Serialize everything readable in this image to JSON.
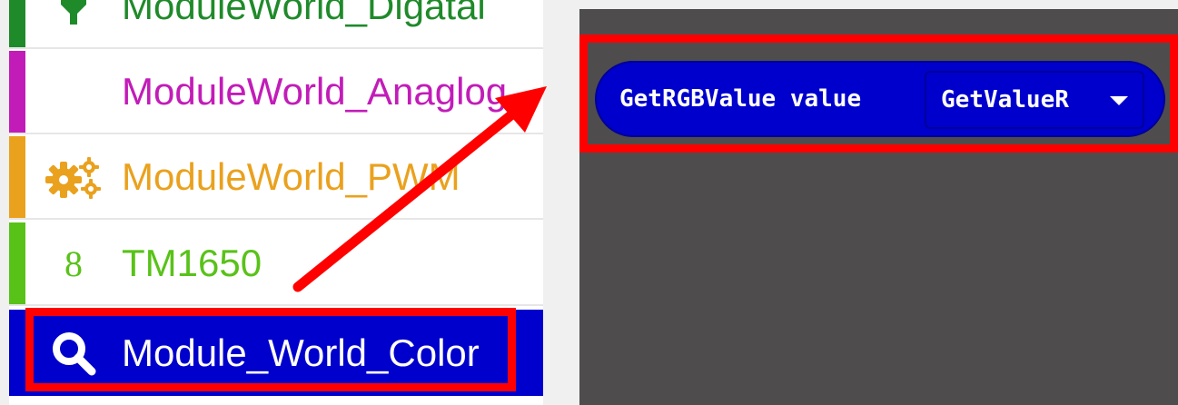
{
  "sidebar": {
    "items": [
      {
        "label": "ModuleWorld_Digatal",
        "color": "#1f8a2a",
        "icon": "plug-icon"
      },
      {
        "label": "ModuleWorld_Anaglog",
        "color": "#c21cb8",
        "icon": ""
      },
      {
        "label": "ModuleWorld_PWM",
        "color": "#eaa11d",
        "icon": "gears-icon"
      },
      {
        "label": "TM1650",
        "color": "#59c219",
        "icon": "digit-icon",
        "icon_text": "8"
      },
      {
        "label": "Module_World_Color",
        "color": "#0000cc",
        "icon": "search-icon",
        "selected": true
      }
    ]
  },
  "workspace": {
    "block": {
      "text": "GetRGBValue value",
      "color": "#0000cc",
      "dropdown": {
        "selected": "GetValueR"
      }
    }
  },
  "annotations": {
    "highlight_color": "#ff0000"
  }
}
